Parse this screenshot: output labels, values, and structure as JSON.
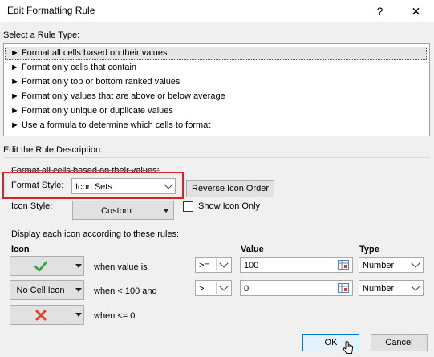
{
  "window": {
    "title": "Edit Formatting Rule",
    "help": "?",
    "close": "✕"
  },
  "rule_type": {
    "label": "Select a Rule Type:",
    "items": [
      "► Format all cells based on their values",
      "► Format only cells that contain",
      "► Format only top or bottom ranked values",
      "► Format only values that are above or below average",
      "► Format only unique or duplicate values",
      "► Use a formula to determine which cells to format"
    ],
    "selected_index": 0
  },
  "description": {
    "label": "Edit the Rule Description:",
    "heading": "Format all cells based on their values:",
    "format_style_label": "Format Style:",
    "format_style_value": "Icon Sets",
    "reverse_button": "Reverse Icon Order",
    "icon_style_label": "Icon Style:",
    "icon_style_value": "Custom",
    "show_icon_only": "Show Icon Only",
    "rules_caption": "Display each icon according to these rules:",
    "col_icon": "Icon",
    "col_value": "Value",
    "col_type": "Type",
    "rows": [
      {
        "icon": "green-check",
        "icon_label": "",
        "condition": "when value is",
        "operator": ">=",
        "value": "100",
        "type": "Number"
      },
      {
        "icon": "no-cell-icon",
        "icon_label": "No Cell Icon",
        "condition": "when < 100 and",
        "operator": ">",
        "value": "0",
        "type": "Number"
      },
      {
        "icon": "red-x",
        "icon_label": "",
        "condition": "when <= 0"
      }
    ]
  },
  "footer": {
    "ok": "OK",
    "cancel": "Cancel"
  },
  "colors": {
    "highlight": "#e02020",
    "check": "#3aa346",
    "x": "#e0442a"
  }
}
